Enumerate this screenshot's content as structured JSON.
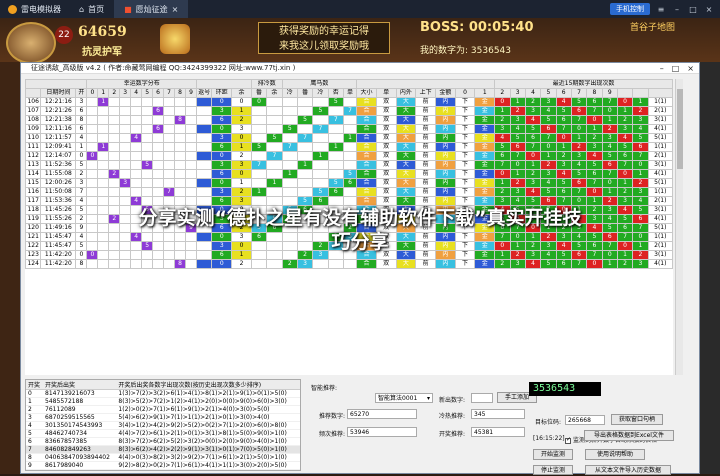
{
  "emulator": {
    "app_name": "雷电模拟器",
    "tab_home": "首页",
    "tab_game": "愿灿征途",
    "control_button": "手机控制"
  },
  "game_hud": {
    "level": "22",
    "gold": "64659",
    "chapter": "抗灵护军",
    "ad_line1": "获得奖励的幸运记得",
    "ad_line2": "来我这儿领取奖励哦",
    "boss_label": "BOSS:",
    "boss_time": "00:05:40",
    "my_number_label": "我的数字为:",
    "my_number": "3536543",
    "top_right": "首谷子地图"
  },
  "app_window": {
    "title": "征途诱敌_高级版 v4.2 ( 作者:命藏莺网编程 QQ:3424399322 网址:www.77tj.xin )"
  },
  "grid": {
    "group_headers": {
      "col1": "幸运数字分布",
      "col2": "排冷数",
      "col3": "鹰马数",
      "col4": "最近15期数字出现次数"
    },
    "header_row2": [
      "日期时间",
      "开",
      "0",
      "1",
      "2",
      "3",
      "4",
      "5",
      "6",
      "7",
      "8",
      "9",
      "返号",
      "环距",
      "余",
      "番",
      "余",
      "冷",
      "番",
      "冷",
      "否",
      "单",
      "大小",
      "单",
      "内外",
      "上下",
      "金额"
    ],
    "rows": [
      {
        "id": "106",
        "time": "12:21:16",
        "open": "3",
        "pos": 1
      },
      {
        "id": "107",
        "time": "12:21:26",
        "open": "6",
        "pos": 6
      },
      {
        "id": "108",
        "time": "12:21:38",
        "open": "8",
        "pos": 8
      },
      {
        "id": "109",
        "time": "12:11:16",
        "open": "6",
        "pos": 6
      },
      {
        "id": "110",
        "time": "12:11:57",
        "open": "4",
        "pos": 4
      },
      {
        "id": "111",
        "time": "12:09:41",
        "open": "1",
        "pos": 1
      },
      {
        "id": "112",
        "time": "12:14:07",
        "open": "0",
        "pos": 0
      },
      {
        "id": "113",
        "time": "11:52:36",
        "open": "5",
        "pos": 5
      },
      {
        "id": "114",
        "time": "11:55:08",
        "open": "2",
        "pos": 2
      },
      {
        "id": "115",
        "time": "12:00:26",
        "open": "3",
        "pos": 3
      },
      {
        "id": "116",
        "time": "11:50:08",
        "open": "7",
        "pos": 7
      },
      {
        "id": "117",
        "time": "11:53:36",
        "open": "4",
        "pos": 4
      },
      {
        "id": "118",
        "time": "11:45:26",
        "open": "5",
        "pos": 5
      },
      {
        "id": "119",
        "time": "11:55:26",
        "open": "2",
        "pos": 2
      },
      {
        "id": "120",
        "time": "11:49:16",
        "open": "9",
        "pos": 9
      },
      {
        "id": "121",
        "time": "11:45:47",
        "open": "4",
        "pos": 4
      },
      {
        "id": "122",
        "time": "11:45:47",
        "open": "5",
        "pos": 5
      },
      {
        "id": "123",
        "time": "11:42:20",
        "open": "0",
        "pos": 0
      },
      {
        "id": "124",
        "time": "11:42:20",
        "open": "8",
        "pos": 8
      }
    ]
  },
  "list_panel": {
    "headers": [
      "开奖",
      "开奖后出奖",
      "开奖后出奖各数字出现次数(按历史出现次数多少排序)"
    ],
    "rows": [
      [
        "0",
        "8147139216073",
        "1(3)>7(2)>3(2)>6(1)>4(1)>8(1)>2(1)>9(1)>0(1)>5(0)"
      ],
      [
        "1",
        "5485572188",
        "8(3)>5(2)>7(2)>1(2)>4(1)>2(0)>0(0)>9(0)>6(0)>3(0)"
      ],
      [
        "2",
        "76112089",
        "1(2)>0(2)>7(1)>6(1)>9(1)>2(1)>4(0)>3(0)>5(0)"
      ],
      [
        "3",
        "6870259515565",
        "5(4)>6(2)>9(1)>7(1)>1(1)>2(1)>0(1)>3(0)>4(0)"
      ],
      [
        "4",
        "301350174543993",
        "3(4)>1(2)>4(2)>9(2)>5(2)>0(2)>7(1)>2(0)>6(0)>8(0)"
      ],
      [
        "5",
        "48462740734",
        "4(4)>7(2)>6(1)>2(1)>0(1)>3(1)>8(1)>5(0)>9(0)>1(0)"
      ],
      [
        "6",
        "83667857385",
        "8(3)>7(2)>6(2)>5(2)>3(2)>0(0)>2(0)>9(0)>4(0)>1(0)"
      ],
      [
        "7",
        "846082849263",
        "8(3)>6(2)>4(2)>2(2)>9(1)>3(1)>0(1)>7(0)>5(0)>1(0)"
      ],
      [
        "8",
        "04063847093894402",
        "4(4)>0(3)>8(2)>3(2)>9(2)>7(1)>6(1)>2(1)>5(0)>1(0)"
      ],
      [
        "9",
        "8617989040",
        "9(2)>8(2)>0(2)>7(1)>6(1)>4(1)>1(1)>3(0)>2(0)>5(0)"
      ]
    ]
  },
  "controls": {
    "smart_recommend": "智能推荐:",
    "algo_select": "智能算法0001",
    "new_number_label": "新出数字:",
    "manual_add": "手工添加",
    "recommend_label": "推荐数字:",
    "recommend_value": "65270",
    "cold_label": "冷热推荐:",
    "cold_value": "345",
    "freq_label": "频次推荐:",
    "freq_value": "53946",
    "open_label": "开奖推荐:",
    "open_value": "45381",
    "display_number": "3536543",
    "target_label": "目标位码:",
    "target_value": "265668",
    "get_target": "获取窗口句柄",
    "time_stamp": "[16:15:22]",
    "auto_add_label": "监测到新开数字自动添加到表格",
    "start_monitor": "开始监测",
    "help": "使用说明帮助",
    "stop_monitor": "停止监测",
    "import_history": "从文本文件导入历史数据",
    "export_excel": "导出表格数据到Excel文件"
  },
  "watermark": {
    "line1": "分享实测“德扑之星有没有辅助软件下载”真实开挂技",
    "line2": "巧分享"
  },
  "colors": {
    "green": "#22aa22",
    "red": "#dd2222",
    "purple": "#8e3bd6",
    "blue": "#2e5bd6",
    "yellow": "#e8e020",
    "orange": "#f0a040",
    "cyan": "#38c0e0"
  }
}
